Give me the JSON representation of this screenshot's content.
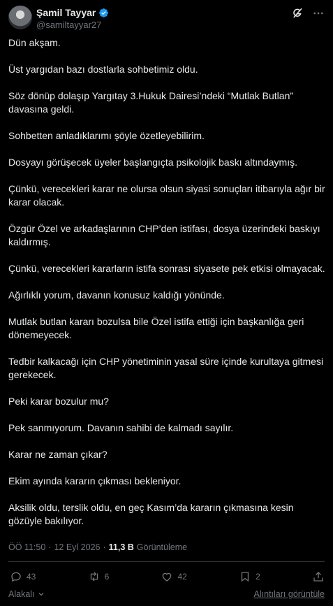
{
  "author": {
    "name": "Şamil Tayyar",
    "handle": "@samiltayyar27"
  },
  "tweet": {
    "paragraphs": [
      "Dün akşam.",
      "Üst yargıdan bazı dostlarla sohbetimiz oldu.",
      "Söz dönüp dolaşıp Yargıtay 3.Hukuk Dairesi’ndeki “Mutlak Butlan” davasına geldi.",
      "Sohbetten anladıklarımı şöyle özetleyebilirim.",
      "Dosyayı görüşecek üyeler başlangıçta psikolojik baskı altındaymış.",
      "Çünkü, verecekleri karar ne olursa  olsun siyasi sonuçları itibarıyla ağır bir karar olacak.",
      "Özgür Özel ve arkadaşlarının CHP’den istifası, dosya üzerindeki baskıyı kaldırmış.",
      "Çünkü, verecekleri kararların istifa sonrası siyasete pek etkisi olmayacak.",
      "Ağırlıklı yorum, davanın konusuz kaldığı yönünde.",
      "Mutlak butlan kararı bozulsa bile Özel istifa ettiği için başkanlığa geri dönemeyecek.",
      "Tedbir kalkacağı için CHP yönetiminin yasal süre içinde kurultaya gitmesi gerekecek.",
      "Peki karar bozulur mu?",
      "Pek sanmıyorum. Davanın sahibi de kalmadı sayılır.",
      "Karar ne zaman çıkar?",
      "Ekim ayında kararın çıkması bekleniyor.",
      "Aksilik oldu, terslik oldu, en geç Kasım’da kararın çıkmasına kesin gözüyle bakılıyor."
    ]
  },
  "meta": {
    "time": "ÖÖ 11:50",
    "separator": "·",
    "date": "12 Eyl 2026",
    "views_count": "11,3 B",
    "views_label": "Görüntüleme"
  },
  "actions": {
    "replies": "43",
    "reposts": "6",
    "likes": "42",
    "bookmarks": "2"
  },
  "footer": {
    "reply_setting": "Alakalı",
    "quotes_link": "Alıntıları görüntüle"
  },
  "colors": {
    "background": "#000000",
    "text": "#e7e9ea",
    "muted": "#71767b",
    "verified": "#1d9bf0",
    "divider": "#2f3336"
  },
  "icons": [
    "verified-badge-icon",
    "grok-icon",
    "more-icon",
    "reply-icon",
    "repost-icon",
    "like-icon",
    "bookmark-icon",
    "share-icon",
    "chevron-down-icon"
  ]
}
